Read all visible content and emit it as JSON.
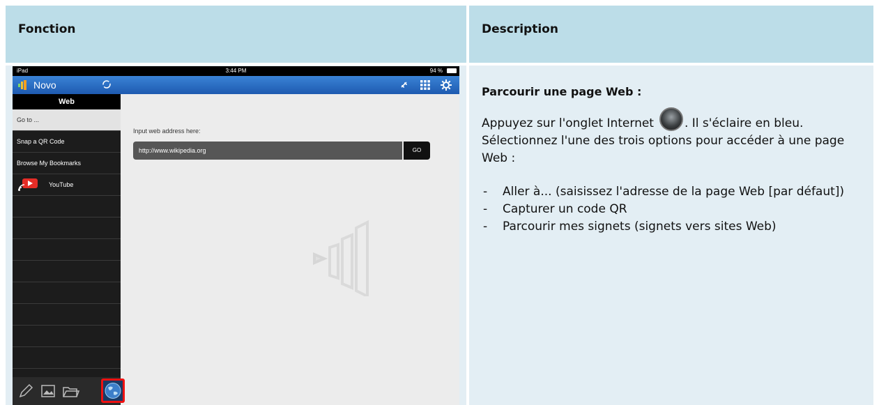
{
  "table": {
    "header_left": "Fonction",
    "header_right": "Description"
  },
  "ipad": {
    "status": {
      "left": "iPad",
      "time": "3:44 PM",
      "battery": "94 %"
    },
    "app_name": "Novo",
    "sidebar": {
      "title": "Web",
      "items": [
        {
          "label": "Go to ..."
        },
        {
          "label": "Snap a QR Code"
        },
        {
          "label": "Browse My Bookmarks"
        },
        {
          "label": "YouTube"
        }
      ]
    },
    "content": {
      "input_label": "Input web address here:",
      "url_value": "http://www.wikipedia.org",
      "go_label": "GO"
    }
  },
  "description": {
    "title": "Parcourir une page Web :",
    "para_before_icon": "Appuyez sur l'onglet Internet",
    "para_after_icon": ". Il s'éclaire en bleu. Sélectionnez l'une des trois options pour accéder à une page Web :",
    "bullets": [
      "Aller à... (saisissez l'adresse de la page Web [par défaut])",
      "Capturer un code QR",
      "Parcourir mes signets (signets vers sites Web)"
    ]
  }
}
